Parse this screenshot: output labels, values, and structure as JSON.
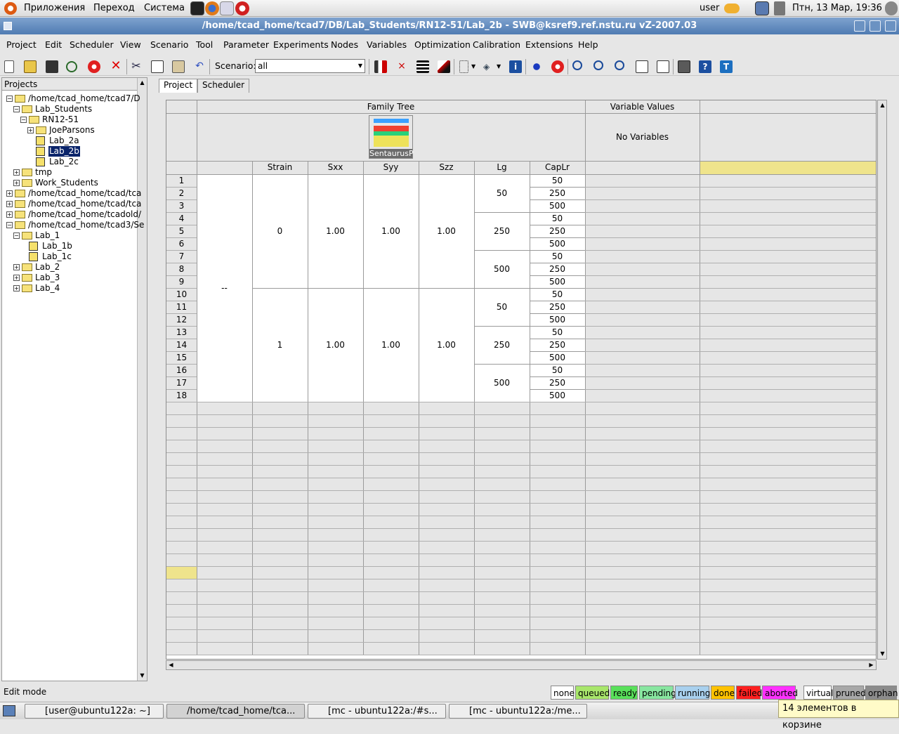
{
  "topbar": {
    "apps": "Приложения",
    "places": "Переход",
    "system": "Система",
    "user": "user",
    "clock": "Птн, 13 Мар, 19:36"
  },
  "window": {
    "title": "/home/tcad_home/tcad7/DB/Lab_Students/RN12-51/Lab_2b - SWB@ksref9.ref.nstu.ru vZ-2007.03"
  },
  "menu": [
    "Project",
    "Edit",
    "Scheduler",
    "View",
    "Scenario",
    "Tool",
    "Parameter",
    "Experiments",
    "Nodes",
    "Variables",
    "Optimization",
    "Calibration",
    "Extensions",
    "Help"
  ],
  "toolbar": {
    "scenario_label": "Scenario:",
    "scenario_value": "all"
  },
  "projects_panel": {
    "header": "Projects",
    "nodes": [
      {
        "label": "/home/tcad_home/tcad7/D",
        "type": "folder",
        "level": 0
      },
      {
        "label": "Lab_Students",
        "type": "folder",
        "level": 1
      },
      {
        "label": "RN12-51",
        "type": "folder",
        "level": 2
      },
      {
        "label": "JoeParsons",
        "type": "folder",
        "level": 3
      },
      {
        "label": "Lab_2a",
        "type": "project",
        "level": 3
      },
      {
        "label": "Lab_2b",
        "type": "project",
        "level": 3,
        "selected": true
      },
      {
        "label": "Lab_2c",
        "type": "project",
        "level": 3
      },
      {
        "label": "tmp",
        "type": "folder",
        "level": 1
      },
      {
        "label": "Work_Students",
        "type": "folder",
        "level": 1
      },
      {
        "label": "/home/tcad_home/tcad/tca",
        "type": "folder",
        "level": 0
      },
      {
        "label": "/home/tcad_home/tcad/tca",
        "type": "folder",
        "level": 0
      },
      {
        "label": "/home/tcad_home/tcadold/",
        "type": "folder",
        "level": 0
      },
      {
        "label": "/home/tcad_home/tcad3/Se",
        "type": "folder",
        "level": 0
      },
      {
        "label": "Lab_1",
        "type": "folder",
        "level": 1
      },
      {
        "label": "Lab_1b",
        "type": "project",
        "level": 2
      },
      {
        "label": "Lab_1c",
        "type": "project",
        "level": 2
      },
      {
        "label": "Lab_2",
        "type": "folder",
        "level": 1
      },
      {
        "label": "Lab_3",
        "type": "folder",
        "level": 1
      },
      {
        "label": "Lab_4",
        "type": "folder",
        "level": 1
      }
    ]
  },
  "tabs": [
    "Project",
    "Scheduler"
  ],
  "table": {
    "family_tree": "Family Tree",
    "variable_values": "Variable Values",
    "no_variables": "No Variables",
    "tool_label": "SentaurusP",
    "columns": [
      "Strain",
      "Sxx",
      "Syy",
      "Szz",
      "Lg",
      "CapLr"
    ],
    "rows": [
      "1",
      "2",
      "3",
      "4",
      "5",
      "6",
      "7",
      "8",
      "9",
      "10",
      "11",
      "12",
      "13",
      "14",
      "15",
      "16",
      "17",
      "18"
    ],
    "root": "--",
    "strain": [
      "0",
      "1"
    ],
    "stress": "1.00",
    "lg": [
      "50",
      "250",
      "500"
    ],
    "caplr": [
      "50",
      "250",
      "500"
    ]
  },
  "status": {
    "mode": "Edit mode",
    "legend": [
      {
        "label": "none",
        "color": "#ffffff"
      },
      {
        "label": "queued",
        "color": "#a8e66b"
      },
      {
        "label": "ready",
        "color": "#59e05a"
      },
      {
        "label": "pending",
        "color": "#88e6a0"
      },
      {
        "label": "running",
        "color": "#a8d0ee"
      },
      {
        "label": "done",
        "color": "#ffc200"
      },
      {
        "label": "failed",
        "color": "#ff2020"
      },
      {
        "label": "aborted",
        "color": "#ff30ff"
      },
      {
        "label": "virtual",
        "color": "#ffffff"
      },
      {
        "label": "pruned",
        "color": "#a8a8a8"
      },
      {
        "label": "orphan",
        "color": "#8c8c8c"
      }
    ]
  },
  "taskbar": {
    "tasks": [
      "[user@ubuntu122a: ~]",
      "/home/tcad_home/tca...",
      "[mc - ubuntu122a:/#s...",
      "[mc - ubuntu122a:/me..."
    ],
    "tooltip": "14 элементов в корзине"
  },
  "colors": {
    "title_bar": "#5b86bb",
    "selected_item": "#0a246a",
    "highlight_cell": "#efe48c"
  }
}
